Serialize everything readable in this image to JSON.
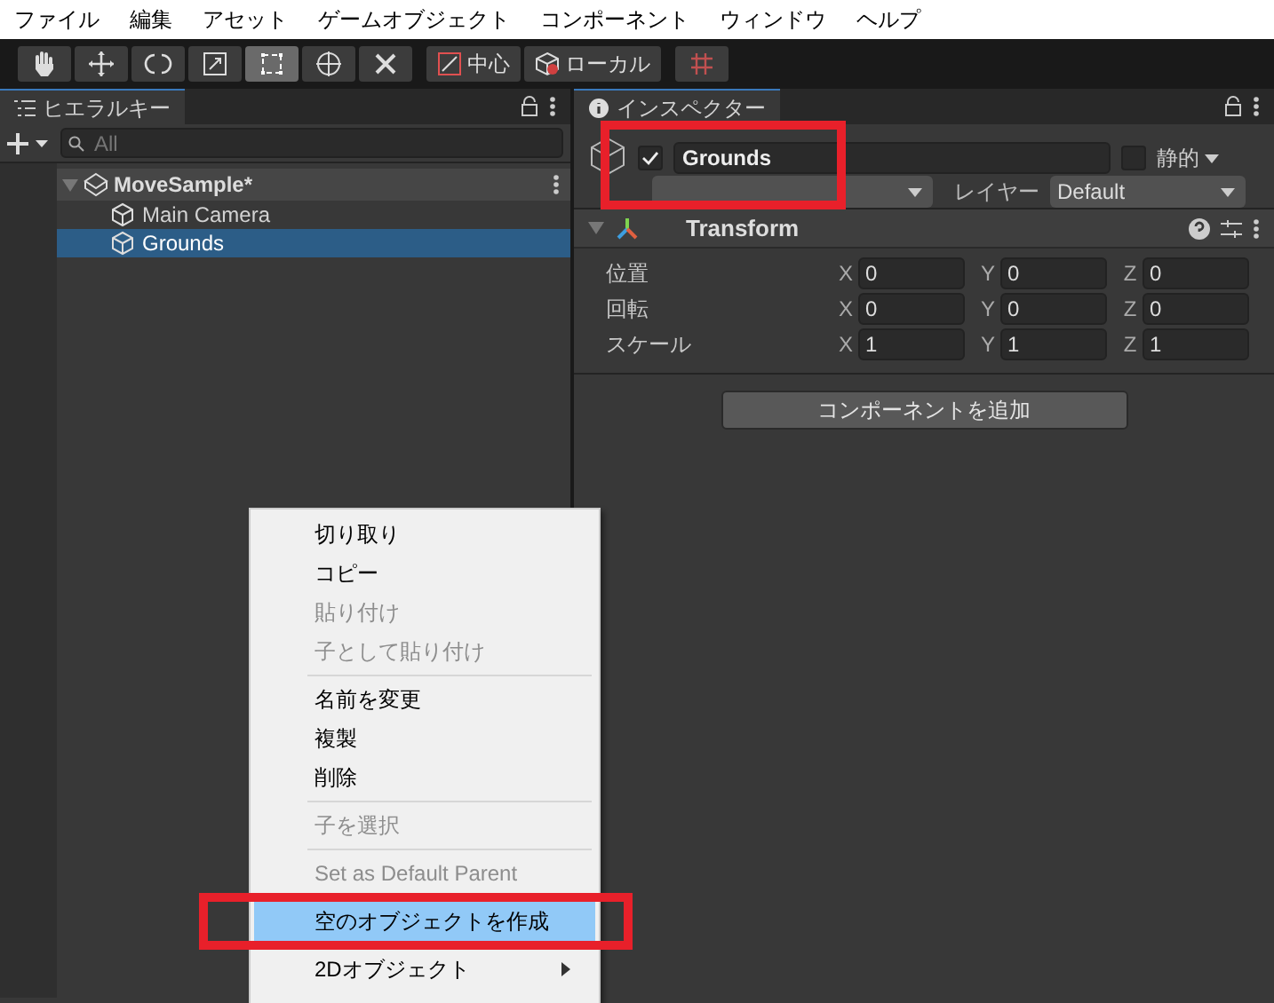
{
  "menubar": [
    "ファイル",
    "編集",
    "アセット",
    "ゲームオブジェクト",
    "コンポーネント",
    "ウィンドウ",
    "ヘルプ"
  ],
  "toolbar": {
    "tools": [
      {
        "kind": "hand",
        "selected": false
      },
      {
        "kind": "move",
        "selected": false
      },
      {
        "kind": "rotate",
        "selected": false
      },
      {
        "kind": "scale",
        "selected": false
      },
      {
        "kind": "rect",
        "selected": true
      },
      {
        "kind": "transform",
        "selected": false
      },
      {
        "kind": "custom",
        "selected": false
      }
    ],
    "pivot": "中心",
    "space": "ローカル"
  },
  "hierarchy": {
    "title": "ヒエラルキー",
    "search_placeholder": "All",
    "scene": {
      "name": "MoveSample*",
      "expanded": true,
      "children": [
        {
          "name": "Main Camera",
          "selected": false
        },
        {
          "name": "Grounds",
          "selected": true
        }
      ]
    }
  },
  "inspector": {
    "title": "インスペクター",
    "object": {
      "active": true,
      "name": "Grounds",
      "highlighted": true,
      "static": false,
      "static_label": "静的",
      "layer_label": "レイヤー",
      "layer": "Default"
    },
    "component": {
      "name": "Transform",
      "expanded": true,
      "rows": [
        {
          "label": "位置",
          "values": [
            {
              "axis": "X",
              "value": "0"
            },
            {
              "axis": "Y",
              "value": "0"
            },
            {
              "axis": "Z",
              "value": "0"
            }
          ]
        },
        {
          "label": "回転",
          "values": [
            {
              "axis": "X",
              "value": "0"
            },
            {
              "axis": "Y",
              "value": "0"
            },
            {
              "axis": "Z",
              "value": "0"
            }
          ]
        },
        {
          "label": "スケール",
          "values": [
            {
              "axis": "X",
              "value": "1"
            },
            {
              "axis": "Y",
              "value": "1"
            },
            {
              "axis": "Z",
              "value": "1"
            }
          ]
        }
      ]
    },
    "add_component": "コンポーネントを追加"
  },
  "context_menu": {
    "items": [
      {
        "kind": "item",
        "label": "切り取り",
        "disabled": false,
        "selected": false,
        "highlighted": false
      },
      {
        "kind": "item",
        "label": "コピー",
        "disabled": false,
        "selected": false,
        "highlighted": false
      },
      {
        "kind": "item",
        "label": "貼り付け",
        "disabled": true,
        "selected": false,
        "highlighted": false
      },
      {
        "kind": "item",
        "label": "子として貼り付け",
        "disabled": true,
        "selected": false,
        "highlighted": false
      },
      {
        "kind": "separator"
      },
      {
        "kind": "item",
        "label": "名前を変更",
        "disabled": false,
        "selected": false,
        "highlighted": false
      },
      {
        "kind": "item",
        "label": "複製",
        "disabled": false,
        "selected": false,
        "highlighted": false
      },
      {
        "kind": "item",
        "label": "削除",
        "disabled": false,
        "selected": false,
        "highlighted": false
      },
      {
        "kind": "separator"
      },
      {
        "kind": "item",
        "label": "子を選択",
        "disabled": true,
        "selected": false,
        "highlighted": false
      },
      {
        "kind": "separator"
      },
      {
        "kind": "item",
        "label": "Set as Default Parent",
        "disabled": true,
        "selected": false,
        "highlighted": false
      },
      {
        "kind": "item",
        "label": "空のオブジェクトを作成",
        "disabled": false,
        "selected": true,
        "highlighted": true
      },
      {
        "kind": "submenu",
        "label": "2Dオブジェクト",
        "disabled": false,
        "selected": false,
        "highlighted": false
      }
    ]
  }
}
